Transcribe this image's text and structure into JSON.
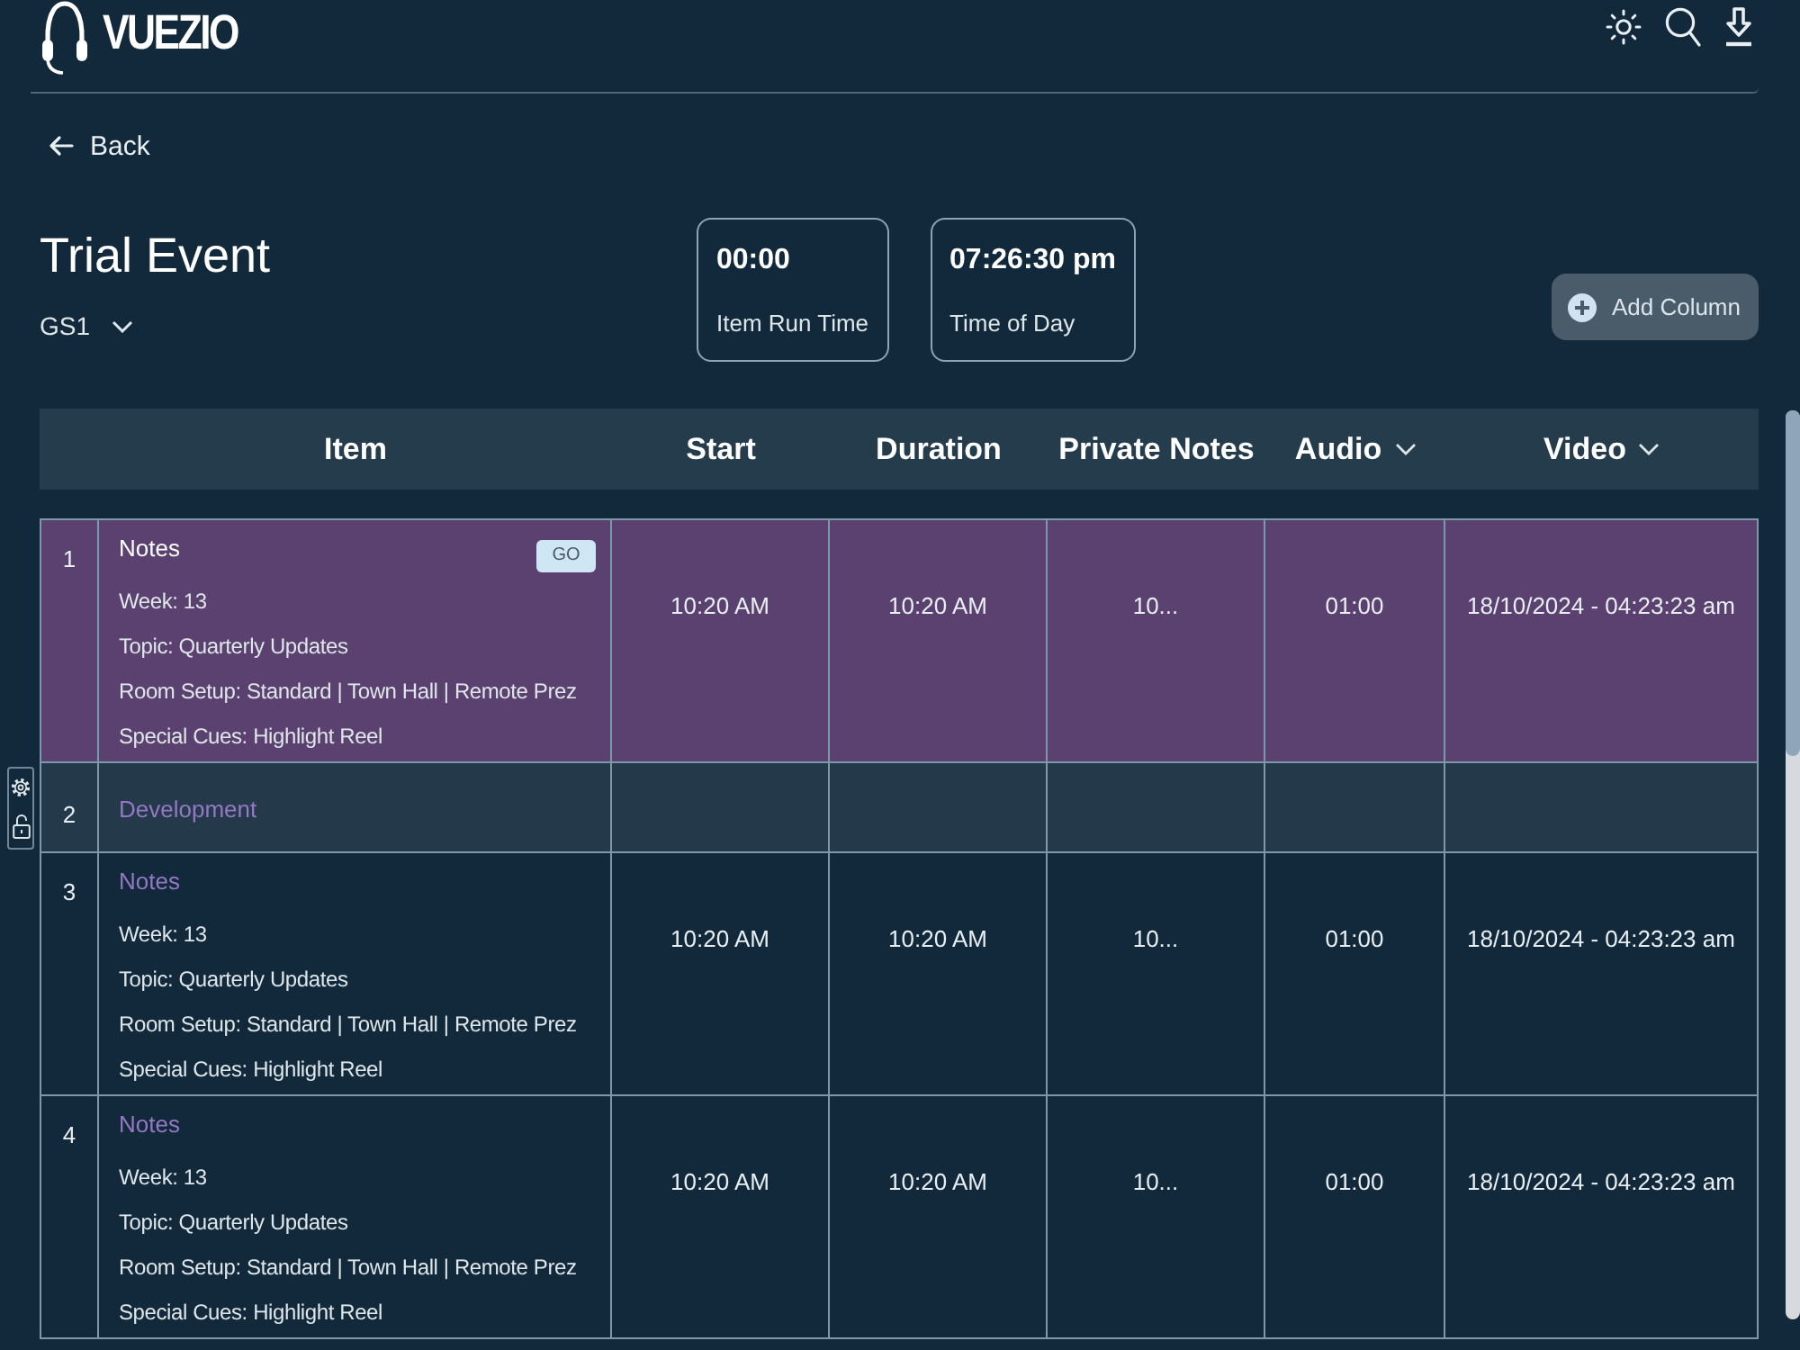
{
  "header": {
    "logo": "VUEZIO"
  },
  "back_button": {
    "label": "Back"
  },
  "event": {
    "title": "Trial Event",
    "stage": "GS1"
  },
  "timers": [
    {
      "value": "00:00",
      "label": "Item Run Time"
    },
    {
      "value": "07:26:30 pm",
      "label": "Time of Day"
    }
  ],
  "add_column_button": {
    "label": "Add Column"
  },
  "table": {
    "columns": [
      {
        "label": "Item",
        "has_menu": false
      },
      {
        "label": "Start",
        "has_menu": false
      },
      {
        "label": "Duration",
        "has_menu": false
      },
      {
        "label": "Private Notes",
        "has_menu": false
      },
      {
        "label": "Audio",
        "has_menu": true
      },
      {
        "label": "Video",
        "has_menu": true
      }
    ],
    "rows": [
      {
        "kind": "item",
        "number": "1",
        "selected": true,
        "title": "Notes",
        "go_button": "GO",
        "details": [
          "Week: 13",
          "Topic: Quarterly Updates",
          "Room Setup: Standard | Town Hall | Remote Prez",
          "Special Cues: Highlight Reel"
        ],
        "cells": [
          "10:20 AM",
          "10:20 AM",
          "10...",
          "01:00",
          "18/10/2024 - 04:23:23 am"
        ]
      },
      {
        "kind": "section",
        "number": "2",
        "selected": false,
        "title": "Development"
      },
      {
        "kind": "item",
        "number": "3",
        "selected": false,
        "title": "Notes",
        "details": [
          "Week: 13",
          "Topic: Quarterly Updates",
          "Room Setup: Standard | Town Hall | Remote Prez",
          "Special Cues: Highlight Reel"
        ],
        "cells": [
          "10:20 AM",
          "10:20 AM",
          "10...",
          "01:00",
          "18/10/2024 - 04:23:23 am"
        ]
      },
      {
        "kind": "item",
        "number": "4",
        "selected": false,
        "title": "Notes",
        "details": [
          "Week: 13",
          "Topic: Quarterly Updates",
          "Room Setup: Standard | Town Hall | Remote Prez",
          "Special Cues: Highlight Reel"
        ],
        "cells": [
          "10:20 AM",
          "10:20 AM",
          "10...",
          "01:00",
          "18/10/2024 - 04:23:23 am"
        ]
      }
    ]
  }
}
